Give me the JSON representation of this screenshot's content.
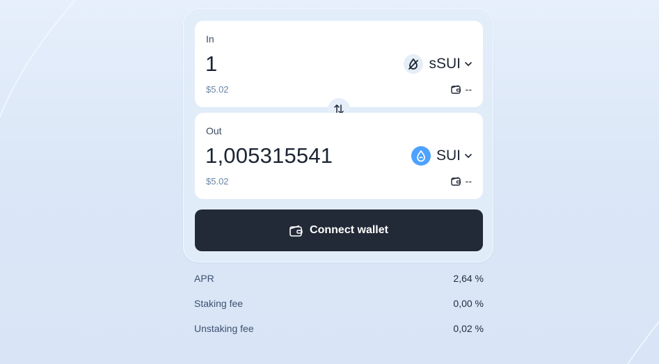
{
  "swap": {
    "input": {
      "label": "In",
      "amount": "1",
      "usd_value": "$5.02",
      "token": {
        "symbol": "sSUI",
        "icon": "ssui-drop-icon"
      },
      "balance": "--"
    },
    "output": {
      "label": "Out",
      "amount": "1,005315541",
      "usd_value": "$5.02",
      "token": {
        "symbol": "SUI",
        "icon": "sui-drop-icon"
      },
      "balance": "--"
    },
    "connect_label": "Connect wallet"
  },
  "stats": [
    {
      "label": "APR",
      "value": "2,64 %"
    },
    {
      "label": "Staking fee",
      "value": "0,00 %"
    },
    {
      "label": "Unstaking fee",
      "value": "0,02 %"
    }
  ],
  "colors": {
    "background": "#dbe7f7",
    "button": "#232a37",
    "sui_blue": "#4da2ff",
    "muted_text": "#6a86a6"
  }
}
